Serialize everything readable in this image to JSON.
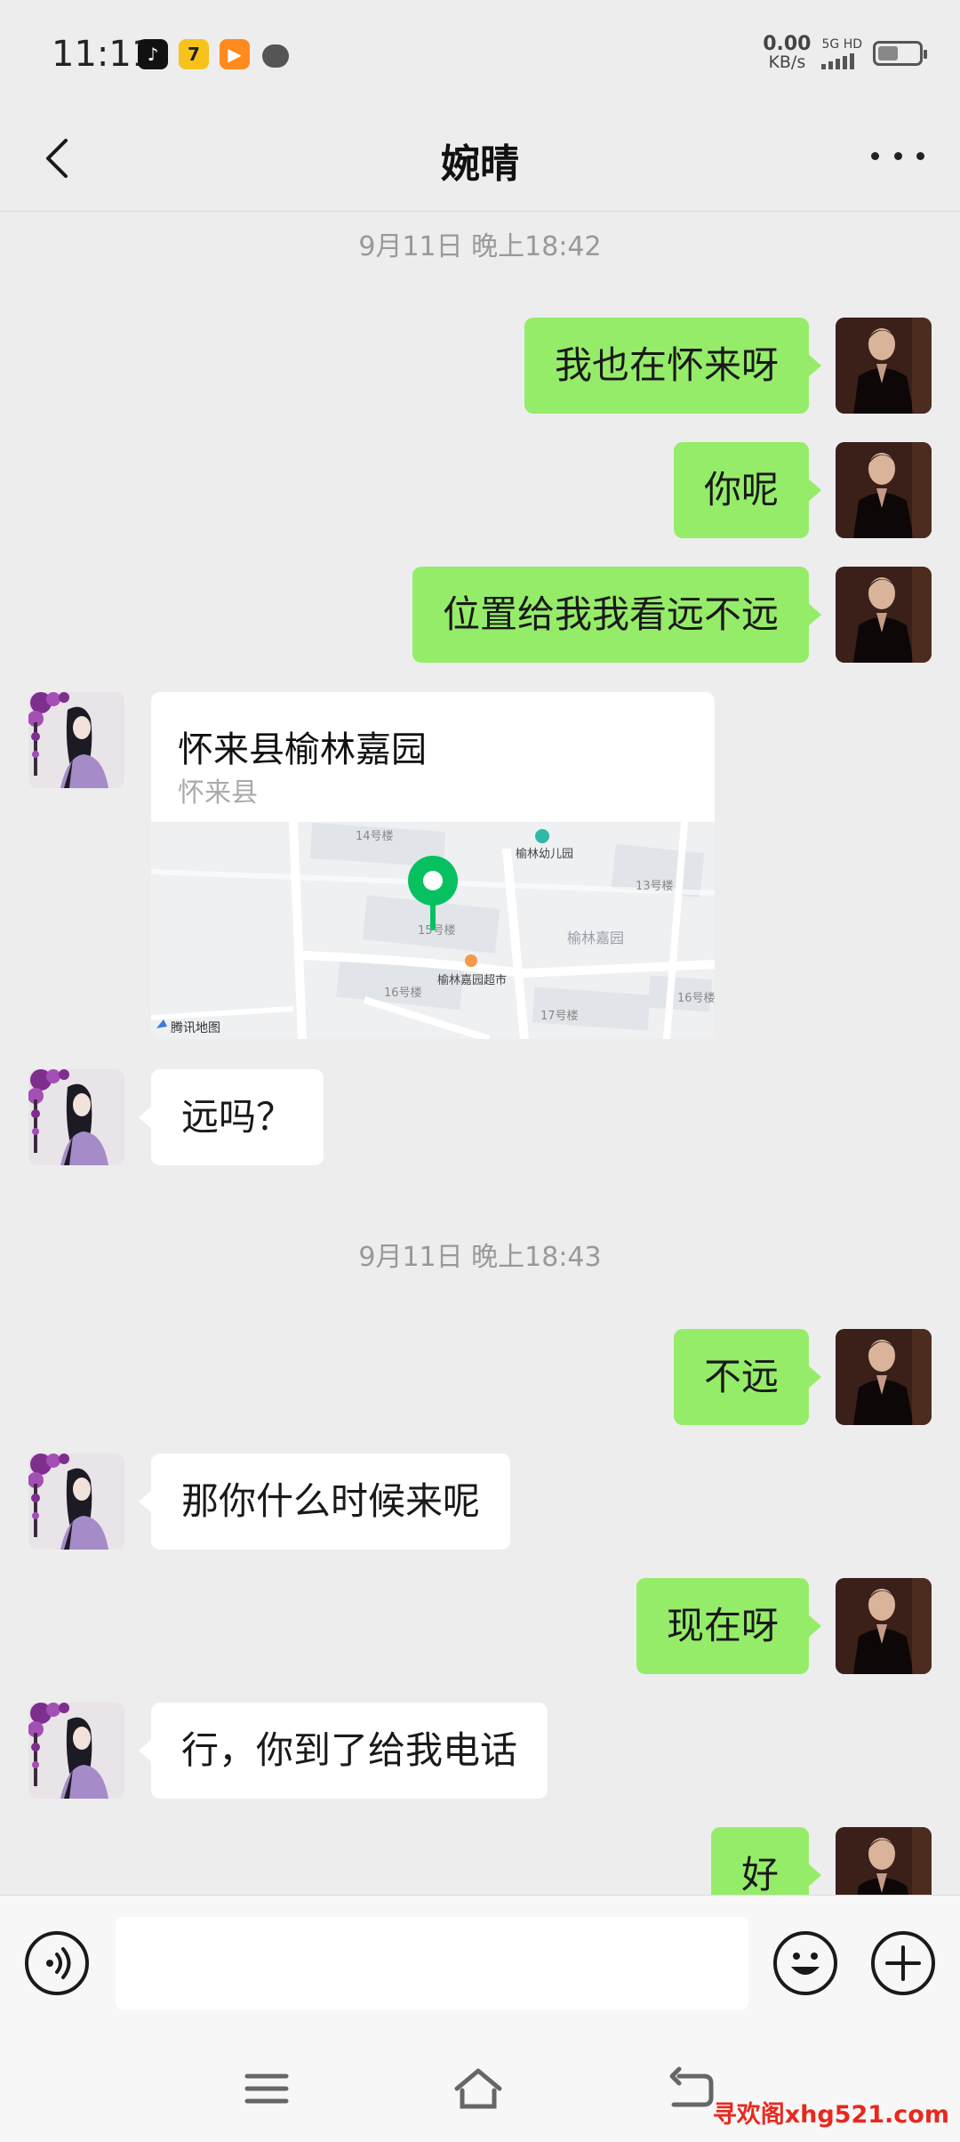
{
  "status_bar": {
    "time": "11:11",
    "net_speed_value": "0.00",
    "net_speed_unit": "KB/s",
    "network": "5G HD",
    "apps": [
      {
        "name": "tiktok-icon",
        "glyph": "♪"
      },
      {
        "name": "seven-app-icon",
        "glyph": "7"
      },
      {
        "name": "video-app-icon",
        "glyph": "▶"
      },
      {
        "name": "chat-notification-icon",
        "glyph": ""
      }
    ]
  },
  "header": {
    "title": "婉晴"
  },
  "messages": [
    {
      "type": "timestamp",
      "text": "9月11日 晚上18:42"
    },
    {
      "type": "text",
      "from": "me",
      "text": "我也在怀来呀"
    },
    {
      "type": "text",
      "from": "me",
      "text": "你呢"
    },
    {
      "type": "text",
      "from": "me",
      "text": "位置给我我看远不远"
    },
    {
      "type": "location",
      "from": "them",
      "name": "怀来县榆林嘉园",
      "address": "怀来县",
      "map_labels": [
        "14号楼",
        "榆林幼儿园",
        "13号楼",
        "15号楼",
        "榆林嘉园",
        "榆林嘉园超市",
        "16号楼",
        "17号楼",
        "16号楼"
      ],
      "map_brand": "腾讯地图"
    },
    {
      "type": "text",
      "from": "them",
      "text": "远吗？"
    },
    {
      "type": "timestamp",
      "text": "9月11日 晚上18:43"
    },
    {
      "type": "text",
      "from": "me",
      "text": "不远"
    },
    {
      "type": "text",
      "from": "them",
      "text": "那你什么时候来呢"
    },
    {
      "type": "text",
      "from": "me",
      "text": "现在呀"
    },
    {
      "type": "text",
      "from": "them",
      "text": "行，你到了给我电话"
    },
    {
      "type": "text",
      "from": "me",
      "text": "好"
    }
  ],
  "input_bar": {
    "value": "",
    "placeholder": ""
  },
  "colors": {
    "background": "#ededed",
    "my_bubble": "#95ec69",
    "their_bubble": "#ffffff",
    "map_pin": "#07c160",
    "watermark": "#e8281e"
  },
  "watermark": {
    "text": "寻欢阁xhg521.com"
  }
}
